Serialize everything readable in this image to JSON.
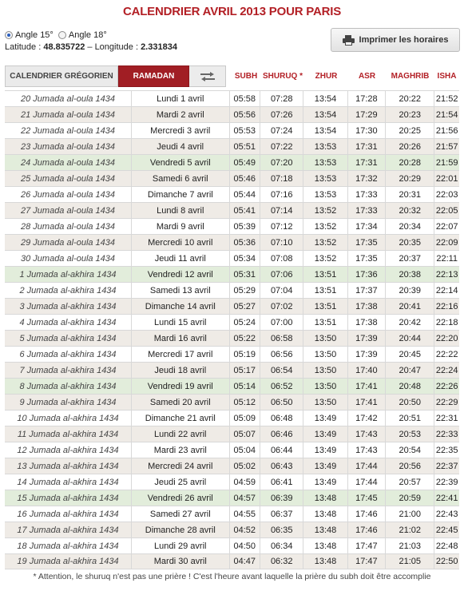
{
  "title": "CALENDRIER AVRIL 2013 POUR PARIS",
  "angles": {
    "option1": "Angle 15°",
    "option2": "Angle 18°",
    "selected": "Angle 15°"
  },
  "location": {
    "lat_label": "Latitude : ",
    "lat_value": "48.835722",
    "sep": " – ",
    "lon_label": "Longitude : ",
    "lon_value": "2.331834"
  },
  "print_button": {
    "label": "Imprimer les horaires",
    "icon": "printer-icon"
  },
  "tabs": {
    "gregorian": "CALENDRIER GRÉGORIEN",
    "ramadan": "RAMADAN",
    "swap_icon": "swap-arrow-icon"
  },
  "columns": {
    "subh": "SUBH",
    "shuruq": "SHURUQ *",
    "zhur": "ZHUR",
    "asr": "ASR",
    "maghrib": "MAGHRIB",
    "isha": "ISHA"
  },
  "colors": {
    "accent": "#b32026",
    "ramadan_tab": "#a11e24",
    "row_even": "#efebe6",
    "row_friday": "#e2eddb"
  },
  "rows": [
    {
      "hijri": "20 Jumada al-oula 1434",
      "greg": "Lundi 1 avril",
      "subh": "05:58",
      "shuruq": "07:28",
      "zhur": "13:54",
      "asr": "17:28",
      "maghrib": "20:22",
      "isha": "21:52",
      "style": "odd"
    },
    {
      "hijri": "21 Jumada al-oula 1434",
      "greg": "Mardi 2 avril",
      "subh": "05:56",
      "shuruq": "07:26",
      "zhur": "13:54",
      "asr": "17:29",
      "maghrib": "20:23",
      "isha": "21:54",
      "style": "even"
    },
    {
      "hijri": "22 Jumada al-oula 1434",
      "greg": "Mercredi 3 avril",
      "subh": "05:53",
      "shuruq": "07:24",
      "zhur": "13:54",
      "asr": "17:30",
      "maghrib": "20:25",
      "isha": "21:56",
      "style": "odd"
    },
    {
      "hijri": "23 Jumada al-oula 1434",
      "greg": "Jeudi 4 avril",
      "subh": "05:51",
      "shuruq": "07:22",
      "zhur": "13:53",
      "asr": "17:31",
      "maghrib": "20:26",
      "isha": "21:57",
      "style": "even"
    },
    {
      "hijri": "24 Jumada al-oula 1434",
      "greg": "Vendredi 5 avril",
      "subh": "05:49",
      "shuruq": "07:20",
      "zhur": "13:53",
      "asr": "17:31",
      "maghrib": "20:28",
      "isha": "21:59",
      "style": "friday"
    },
    {
      "hijri": "25 Jumada al-oula 1434",
      "greg": "Samedi 6 avril",
      "subh": "05:46",
      "shuruq": "07:18",
      "zhur": "13:53",
      "asr": "17:32",
      "maghrib": "20:29",
      "isha": "22:01",
      "style": "even"
    },
    {
      "hijri": "26 Jumada al-oula 1434",
      "greg": "Dimanche 7 avril",
      "subh": "05:44",
      "shuruq": "07:16",
      "zhur": "13:53",
      "asr": "17:33",
      "maghrib": "20:31",
      "isha": "22:03",
      "style": "odd"
    },
    {
      "hijri": "27 Jumada al-oula 1434",
      "greg": "Lundi 8 avril",
      "subh": "05:41",
      "shuruq": "07:14",
      "zhur": "13:52",
      "asr": "17:33",
      "maghrib": "20:32",
      "isha": "22:05",
      "style": "even"
    },
    {
      "hijri": "28 Jumada al-oula 1434",
      "greg": "Mardi 9 avril",
      "subh": "05:39",
      "shuruq": "07:12",
      "zhur": "13:52",
      "asr": "17:34",
      "maghrib": "20:34",
      "isha": "22:07",
      "style": "odd"
    },
    {
      "hijri": "29 Jumada al-oula 1434",
      "greg": "Mercredi 10 avril",
      "subh": "05:36",
      "shuruq": "07:10",
      "zhur": "13:52",
      "asr": "17:35",
      "maghrib": "20:35",
      "isha": "22:09",
      "style": "even"
    },
    {
      "hijri": "30 Jumada al-oula 1434",
      "greg": "Jeudi 11 avril",
      "subh": "05:34",
      "shuruq": "07:08",
      "zhur": "13:52",
      "asr": "17:35",
      "maghrib": "20:37",
      "isha": "22:11",
      "style": "odd"
    },
    {
      "hijri": "1 Jumada al-akhira 1434",
      "greg": "Vendredi 12 avril",
      "subh": "05:31",
      "shuruq": "07:06",
      "zhur": "13:51",
      "asr": "17:36",
      "maghrib": "20:38",
      "isha": "22:13",
      "style": "friday"
    },
    {
      "hijri": "2 Jumada al-akhira 1434",
      "greg": "Samedi 13 avril",
      "subh": "05:29",
      "shuruq": "07:04",
      "zhur": "13:51",
      "asr": "17:37",
      "maghrib": "20:39",
      "isha": "22:14",
      "style": "odd"
    },
    {
      "hijri": "3 Jumada al-akhira 1434",
      "greg": "Dimanche 14 avril",
      "subh": "05:27",
      "shuruq": "07:02",
      "zhur": "13:51",
      "asr": "17:38",
      "maghrib": "20:41",
      "isha": "22:16",
      "style": "even"
    },
    {
      "hijri": "4 Jumada al-akhira 1434",
      "greg": "Lundi 15 avril",
      "subh": "05:24",
      "shuruq": "07:00",
      "zhur": "13:51",
      "asr": "17:38",
      "maghrib": "20:42",
      "isha": "22:18",
      "style": "odd"
    },
    {
      "hijri": "5 Jumada al-akhira 1434",
      "greg": "Mardi 16 avril",
      "subh": "05:22",
      "shuruq": "06:58",
      "zhur": "13:50",
      "asr": "17:39",
      "maghrib": "20:44",
      "isha": "22:20",
      "style": "even"
    },
    {
      "hijri": "6 Jumada al-akhira 1434",
      "greg": "Mercredi 17 avril",
      "subh": "05:19",
      "shuruq": "06:56",
      "zhur": "13:50",
      "asr": "17:39",
      "maghrib": "20:45",
      "isha": "22:22",
      "style": "odd"
    },
    {
      "hijri": "7 Jumada al-akhira 1434",
      "greg": "Jeudi 18 avril",
      "subh": "05:17",
      "shuruq": "06:54",
      "zhur": "13:50",
      "asr": "17:40",
      "maghrib": "20:47",
      "isha": "22:24",
      "style": "even"
    },
    {
      "hijri": "8 Jumada al-akhira 1434",
      "greg": "Vendredi 19 avril",
      "subh": "05:14",
      "shuruq": "06:52",
      "zhur": "13:50",
      "asr": "17:41",
      "maghrib": "20:48",
      "isha": "22:26",
      "style": "friday"
    },
    {
      "hijri": "9 Jumada al-akhira 1434",
      "greg": "Samedi 20 avril",
      "subh": "05:12",
      "shuruq": "06:50",
      "zhur": "13:50",
      "asr": "17:41",
      "maghrib": "20:50",
      "isha": "22:29",
      "style": "even"
    },
    {
      "hijri": "10 Jumada al-akhira 1434",
      "greg": "Dimanche 21 avril",
      "subh": "05:09",
      "shuruq": "06:48",
      "zhur": "13:49",
      "asr": "17:42",
      "maghrib": "20:51",
      "isha": "22:31",
      "style": "odd"
    },
    {
      "hijri": "11 Jumada al-akhira 1434",
      "greg": "Lundi 22 avril",
      "subh": "05:07",
      "shuruq": "06:46",
      "zhur": "13:49",
      "asr": "17:43",
      "maghrib": "20:53",
      "isha": "22:33",
      "style": "even"
    },
    {
      "hijri": "12 Jumada al-akhira 1434",
      "greg": "Mardi 23 avril",
      "subh": "05:04",
      "shuruq": "06:44",
      "zhur": "13:49",
      "asr": "17:43",
      "maghrib": "20:54",
      "isha": "22:35",
      "style": "odd"
    },
    {
      "hijri": "13 Jumada al-akhira 1434",
      "greg": "Mercredi 24 avril",
      "subh": "05:02",
      "shuruq": "06:43",
      "zhur": "13:49",
      "asr": "17:44",
      "maghrib": "20:56",
      "isha": "22:37",
      "style": "even"
    },
    {
      "hijri": "14 Jumada al-akhira 1434",
      "greg": "Jeudi 25 avril",
      "subh": "04:59",
      "shuruq": "06:41",
      "zhur": "13:49",
      "asr": "17:44",
      "maghrib": "20:57",
      "isha": "22:39",
      "style": "odd"
    },
    {
      "hijri": "15 Jumada al-akhira 1434",
      "greg": "Vendredi 26 avril",
      "subh": "04:57",
      "shuruq": "06:39",
      "zhur": "13:48",
      "asr": "17:45",
      "maghrib": "20:59",
      "isha": "22:41",
      "style": "friday"
    },
    {
      "hijri": "16 Jumada al-akhira 1434",
      "greg": "Samedi 27 avril",
      "subh": "04:55",
      "shuruq": "06:37",
      "zhur": "13:48",
      "asr": "17:46",
      "maghrib": "21:00",
      "isha": "22:43",
      "style": "odd"
    },
    {
      "hijri": "17 Jumada al-akhira 1434",
      "greg": "Dimanche 28 avril",
      "subh": "04:52",
      "shuruq": "06:35",
      "zhur": "13:48",
      "asr": "17:46",
      "maghrib": "21:02",
      "isha": "22:45",
      "style": "even"
    },
    {
      "hijri": "18 Jumada al-akhira 1434",
      "greg": "Lundi 29 avril",
      "subh": "04:50",
      "shuruq": "06:34",
      "zhur": "13:48",
      "asr": "17:47",
      "maghrib": "21:03",
      "isha": "22:48",
      "style": "odd"
    },
    {
      "hijri": "19 Jumada al-akhira 1434",
      "greg": "Mardi 30 avril",
      "subh": "04:47",
      "shuruq": "06:32",
      "zhur": "13:48",
      "asr": "17:47",
      "maghrib": "21:05",
      "isha": "22:50",
      "style": "even"
    }
  ],
  "footnote": "* Attention, le shuruq n'est pas une prière ! C'est l'heure avant laquelle la prière du subh doit être accomplie"
}
